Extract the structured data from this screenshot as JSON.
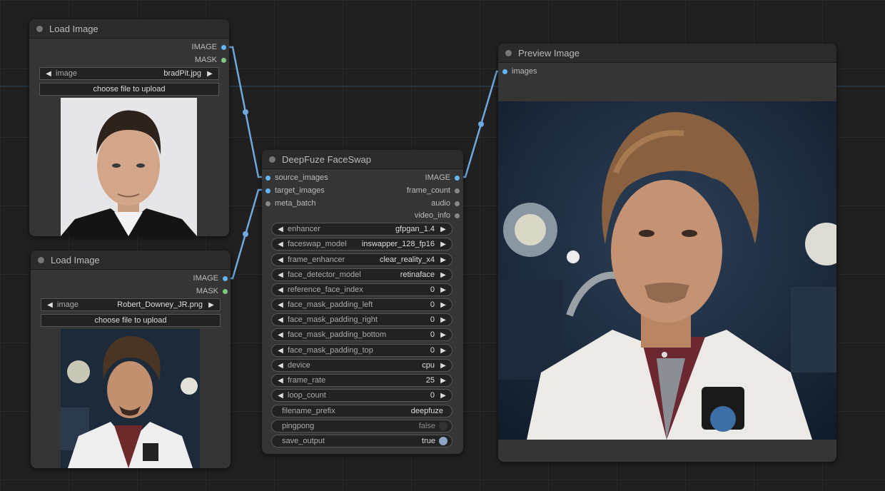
{
  "colors": {
    "link": "#64b5f6",
    "image_slot": "#64b5f6",
    "mask_slot": "#81c784"
  },
  "load_image_1": {
    "title": "Load Image",
    "outputs": [
      "IMAGE",
      "MASK"
    ],
    "image_widget": {
      "label": "image",
      "value": "bradPit.jpg"
    },
    "upload_label": "choose file to upload"
  },
  "load_image_2": {
    "title": "Load Image",
    "outputs": [
      "IMAGE",
      "MASK"
    ],
    "image_widget": {
      "label": "image",
      "value": "Robert_Downey_JR.png"
    },
    "upload_label": "choose file to upload"
  },
  "faceswap": {
    "title": "DeepFuze FaceSwap",
    "inputs": [
      "source_images",
      "target_images",
      "meta_batch"
    ],
    "outputs": [
      "IMAGE",
      "frame_count",
      "audio",
      "video_info"
    ],
    "widgets": [
      {
        "label": "enhancer",
        "value": "gfpgan_1.4"
      },
      {
        "label": "faceswap_model",
        "value": "inswapper_128_fp16"
      },
      {
        "label": "frame_enhancer",
        "value": "clear_reality_x4"
      },
      {
        "label": "face_detector_model",
        "value": "retinaface"
      },
      {
        "label": "reference_face_index",
        "value": "0"
      },
      {
        "label": "face_mask_padding_left",
        "value": "0"
      },
      {
        "label": "face_mask_padding_right",
        "value": "0"
      },
      {
        "label": "face_mask_padding_bottom",
        "value": "0"
      },
      {
        "label": "face_mask_padding_top",
        "value": "0"
      },
      {
        "label": "device",
        "value": "cpu"
      },
      {
        "label": "frame_rate",
        "value": "25"
      },
      {
        "label": "loop_count",
        "value": "0"
      }
    ],
    "text_widget": {
      "label": "filename_prefix",
      "value": "deepfuze"
    },
    "toggles": [
      {
        "label": "pingpong",
        "value": "false"
      },
      {
        "label": "save_output",
        "value": "true"
      }
    ]
  },
  "preview": {
    "title": "Preview Image",
    "inputs": [
      "images"
    ]
  },
  "icons": {
    "left_arrow": "◀",
    "right_arrow": "▶"
  }
}
